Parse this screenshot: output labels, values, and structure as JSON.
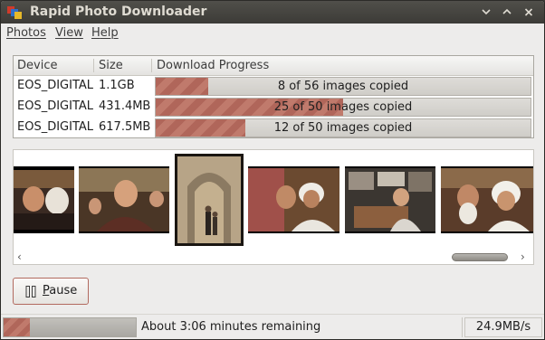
{
  "window": {
    "title": "Rapid Photo Downloader",
    "buttons": {
      "minimize": "chevron-down-icon",
      "maximize": "chevron-up-icon",
      "close": "close-icon"
    }
  },
  "menu": {
    "items": [
      {
        "label": "Photos",
        "mnemonic": "P",
        "rest": "hotos"
      },
      {
        "label": "View",
        "mnemonic": "V",
        "rest": "iew"
      },
      {
        "label": "Help",
        "mnemonic": "H",
        "rest": "elp"
      }
    ]
  },
  "device_table": {
    "columns": [
      "Device",
      "Size",
      "Download Progress"
    ],
    "rows": [
      {
        "device": "EOS_DIGITAL",
        "size": "1.1GB",
        "progress_text": "8 of 56 images copied",
        "progress": 0.14
      },
      {
        "device": "EOS_DIGITAL",
        "size": "431.4MB",
        "progress_text": "25 of 50 images copied",
        "progress": 0.5
      },
      {
        "device": "EOS_DIGITAL",
        "size": "617.5MB",
        "progress_text": "12 of 50 images copied",
        "progress": 0.24
      }
    ]
  },
  "thumbnails": {
    "count": 6,
    "scroll_left_icon": "chevron-left-icon",
    "scroll_right_icon": "chevron-right-icon"
  },
  "controls": {
    "pause_label_mnemonic": "P",
    "pause_label_rest": "ause",
    "pause_icon": "pause-icon"
  },
  "status": {
    "overall_progress": 0.2,
    "message": "About 3:06 minutes remaining",
    "rate": "24.9MB/s"
  },
  "colors": {
    "progress_fill": "#b0665a",
    "titlebar": "#3c3b37",
    "window_bg": "#edeceb"
  }
}
